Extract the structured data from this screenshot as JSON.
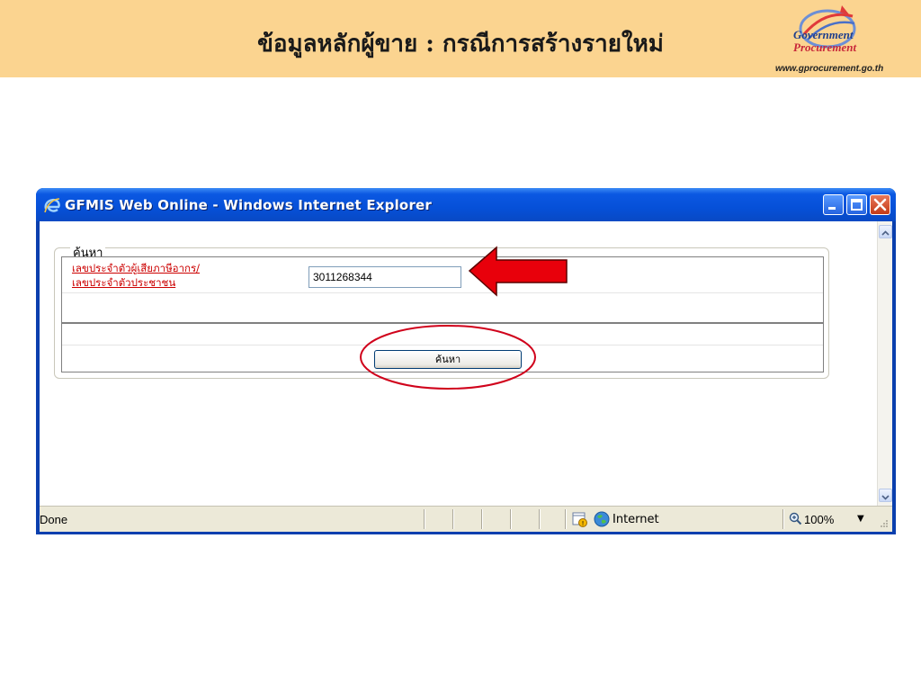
{
  "slide": {
    "title": "ข้อมูลหลักผู้ขาย : กรณีการสร้างรายใหม่",
    "logo": {
      "line1": "Government",
      "line2": "Procurement",
      "url": "www.gprocurement.go.th"
    }
  },
  "window": {
    "title": "GFMIS Web Online - Windows Internet Explorer",
    "icon": "internet-explorer-icon",
    "controls": [
      "minimize-icon",
      "maximize-icon",
      "close-icon"
    ]
  },
  "form": {
    "legend": "ค้นหา",
    "tax_label_line1": "เลขประจำตัวผู้เสียภาษีอากร/",
    "tax_label_line2": "เลขประจำตัวประชาชน",
    "tax_value": "3011268344",
    "search_button": "ค้นหา"
  },
  "annotations": {
    "arrow_color": "#e8000b",
    "ellipse_color": "#d0021b"
  },
  "statusbar": {
    "status": "Done",
    "zone": "Internet",
    "zoom": "100%"
  },
  "colors": {
    "header_bg": "#fbd490",
    "titlebar": "#0650d8",
    "link_red": "#cc0000"
  }
}
